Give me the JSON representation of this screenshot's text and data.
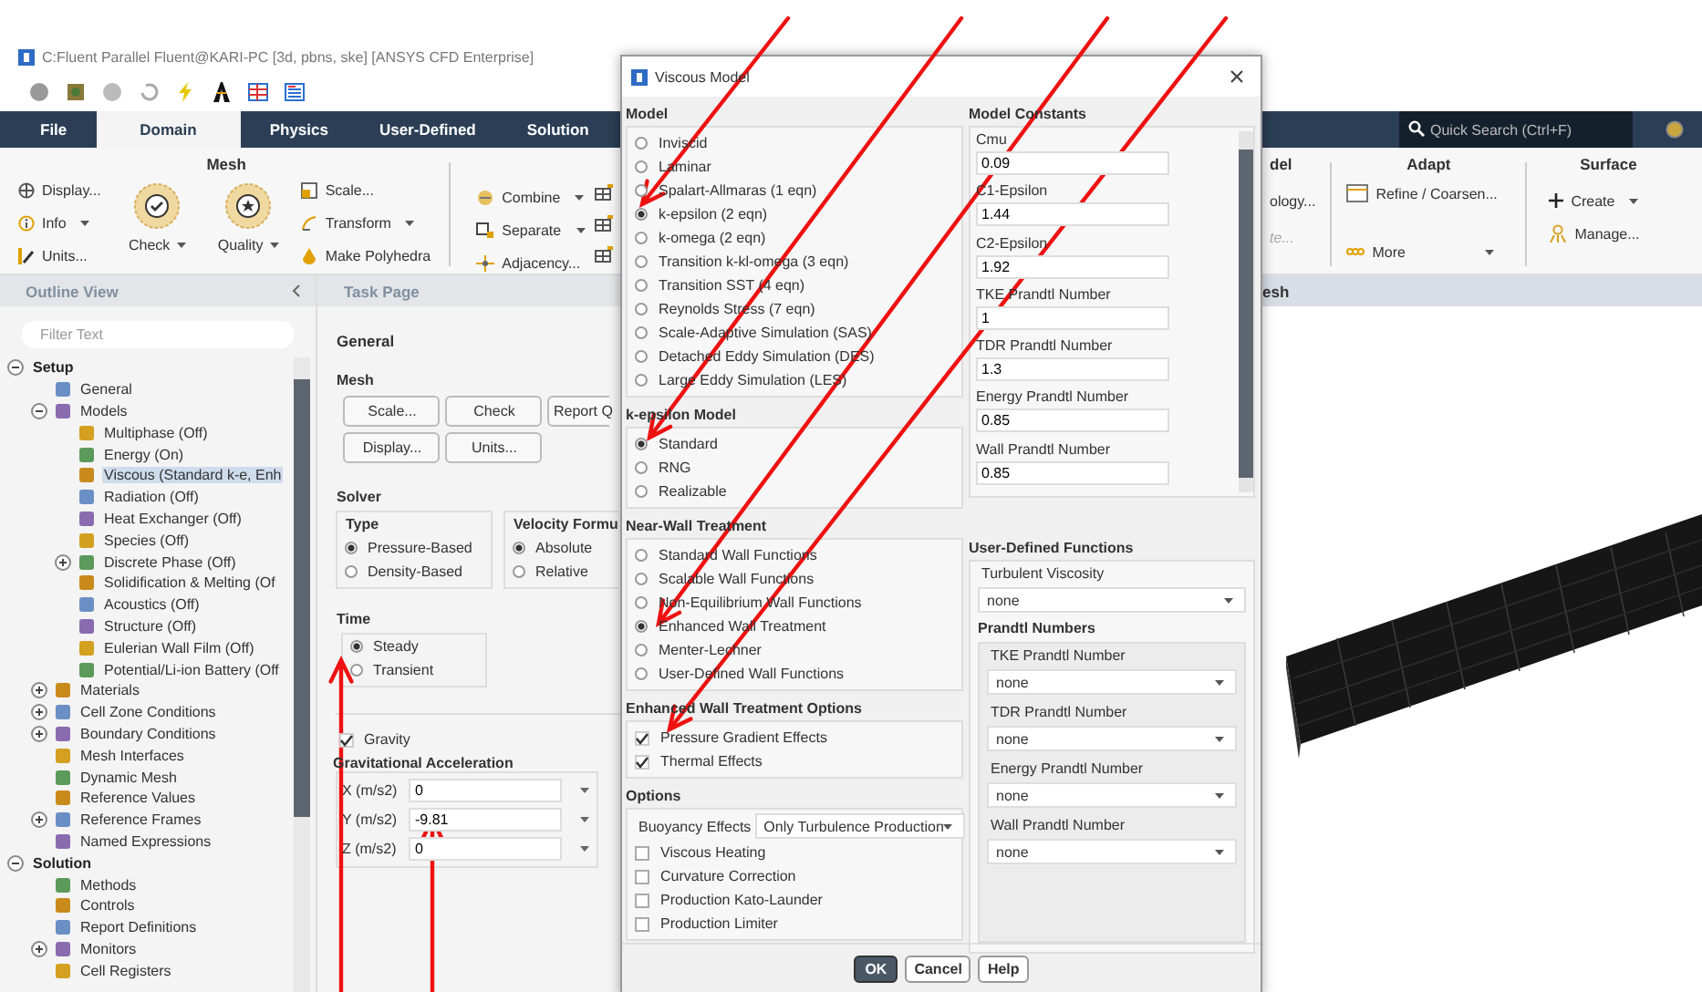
{
  "window": {
    "title": "C:Fluent Parallel Fluent@KARI-PC  [3d, pbns, ske] [ANSYS CFD Enterprise]"
  },
  "ribbon_tabs": [
    {
      "label": "File",
      "selected": false
    },
    {
      "label": "Domain",
      "selected": true
    },
    {
      "label": "Physics",
      "selected": false
    },
    {
      "label": "User-Defined",
      "selected": false
    },
    {
      "label": "Solution",
      "selected": false
    }
  ],
  "quick_search": {
    "placeholder": "Quick Search (Ctrl+F)"
  },
  "ribbon": {
    "mesh_group": {
      "title": "Mesh",
      "col1": [
        "Display...",
        "Info",
        "Units..."
      ],
      "check": "Check",
      "quality": "Quality",
      "col3": [
        "Scale...",
        "Transform",
        "Make Polyhedra"
      ]
    },
    "zones": [
      "Combine",
      "Separate",
      "Adjacency..."
    ],
    "partial_group": {
      "title": "del",
      "items": [
        {
          "label": "ology...",
          "disabled": false
        },
        {
          "label": "te...",
          "disabled": true
        }
      ]
    },
    "adapt": {
      "title": "Adapt",
      "items": [
        "Refine / Coarsen...",
        "More"
      ]
    },
    "surface": {
      "title": "Surface",
      "items": [
        "Create",
        "Manage..."
      ]
    }
  },
  "outline": {
    "header": "Outline View",
    "filter": {
      "placeholder": "Filter Text"
    },
    "items": [
      {
        "label": "Setup",
        "expanded": true,
        "selected": false,
        "children": [
          {
            "label": "General",
            "selected": false
          },
          {
            "label": "Models",
            "expanded": true,
            "selected": false,
            "children": [
              {
                "label": "Multiphase (Off)",
                "selected": false
              },
              {
                "label": "Energy (On)",
                "selected": false
              },
              {
                "label": "Viscous (Standard k-e, Enh",
                "selected": true
              },
              {
                "label": "Radiation (Off)",
                "selected": false
              },
              {
                "label": "Heat Exchanger (Off)",
                "selected": false
              },
              {
                "label": "Species (Off)",
                "selected": false
              },
              {
                "label": "Discrete Phase (Off)",
                "expanded": false,
                "selected": false
              },
              {
                "label": "Solidification & Melting (Of",
                "selected": false
              },
              {
                "label": "Acoustics (Off)",
                "selected": false
              },
              {
                "label": "Structure (Off)",
                "selected": false
              },
              {
                "label": "Eulerian Wall Film (Off)",
                "selected": false
              },
              {
                "label": "Potential/Li-ion Battery (Off",
                "selected": false
              }
            ]
          },
          {
            "label": "Materials",
            "expanded": false,
            "selected": false
          },
          {
            "label": "Cell Zone Conditions",
            "expanded": false,
            "selected": false
          },
          {
            "label": "Boundary Conditions",
            "expanded": false,
            "selected": false
          },
          {
            "label": "Mesh Interfaces",
            "selected": false
          },
          {
            "label": "Dynamic Mesh",
            "selected": false
          },
          {
            "label": "Reference Values",
            "selected": false
          },
          {
            "label": "Reference Frames",
            "expanded": false,
            "selected": false
          },
          {
            "label": "Named Expressions",
            "selected": false
          }
        ]
      },
      {
        "label": "Solution",
        "expanded": true,
        "selected": false,
        "children": [
          {
            "label": "Methods",
            "selected": false
          },
          {
            "label": "Controls",
            "selected": false
          },
          {
            "label": "Report Definitions",
            "selected": false
          },
          {
            "label": "Monitors",
            "expanded": false,
            "selected": false
          },
          {
            "label": "Cell Registers",
            "selected": false
          }
        ]
      }
    ]
  },
  "task_page": {
    "header": "Task Page",
    "title": "General",
    "mesh": {
      "label": "Mesh",
      "buttons": [
        "Scale...",
        "Check",
        "Report Q",
        "Display...",
        "Units..."
      ]
    },
    "solver": {
      "label": "Solver",
      "type": {
        "label": "Type",
        "options": [
          {
            "label": "Pressure-Based",
            "selected": true
          },
          {
            "label": "Density-Based",
            "selected": false
          }
        ]
      },
      "velocity": {
        "label": "Velocity Formu",
        "options": [
          {
            "label": "Absolute",
            "selected": true
          },
          {
            "label": "Relative",
            "selected": false
          }
        ]
      }
    },
    "time": {
      "label": "Time",
      "options": [
        {
          "label": "Steady",
          "selected": true
        },
        {
          "label": "Transient",
          "selected": false
        }
      ]
    },
    "gravity": {
      "label": "Gravity",
      "checked": true
    },
    "gravitational_acceleration": {
      "label": "Gravitational Acceleration",
      "fields": [
        {
          "label": "X (m/s2)",
          "value": "0"
        },
        {
          "label": "Y (m/s2)",
          "value": "-9.81"
        },
        {
          "label": "Z (m/s2)",
          "value": "0"
        }
      ]
    }
  },
  "graphics": {
    "header": "esh"
  },
  "dialog": {
    "title": "Viscous Model",
    "model": {
      "label": "Model",
      "options": [
        {
          "label": "Inviscid",
          "selected": false
        },
        {
          "label": "Laminar",
          "selected": false
        },
        {
          "label": "Spalart-Allmaras (1 eqn)",
          "selected": false
        },
        {
          "label": "k-epsilon (2 eqn)",
          "selected": true
        },
        {
          "label": "k-omega (2 eqn)",
          "selected": false
        },
        {
          "label": "Transition k-kl-omega (3 eqn)",
          "selected": false
        },
        {
          "label": "Transition SST (4 eqn)",
          "selected": false
        },
        {
          "label": "Reynolds Stress (7 eqn)",
          "selected": false
        },
        {
          "label": "Scale-Adaptive Simulation (SAS)",
          "selected": false
        },
        {
          "label": "Detached Eddy Simulation (DES)",
          "selected": false
        },
        {
          "label": "Large Eddy Simulation (LES)",
          "selected": false
        }
      ]
    },
    "k_epsilon_model": {
      "label": "k-epsilon Model",
      "options": [
        {
          "label": "Standard",
          "selected": true
        },
        {
          "label": "RNG",
          "selected": false
        },
        {
          "label": "Realizable",
          "selected": false
        }
      ]
    },
    "near_wall_treatment": {
      "label": "Near-Wall Treatment",
      "options": [
        {
          "label": "Standard Wall Functions",
          "selected": false
        },
        {
          "label": "Scalable Wall Functions",
          "selected": false
        },
        {
          "label": "Non-Equilibrium Wall Functions",
          "selected": false
        },
        {
          "label": "Enhanced Wall Treatment",
          "selected": true
        },
        {
          "label": "Menter-Lechner",
          "selected": false
        },
        {
          "label": "User-Defined Wall Functions",
          "selected": false
        }
      ]
    },
    "enhanced_wall_treatment_options": {
      "label": "Enhanced Wall Treatment Options",
      "options": [
        {
          "label": "Pressure Gradient Effects",
          "checked": true
        },
        {
          "label": "Thermal Effects",
          "checked": true
        }
      ]
    },
    "options": {
      "label": "Options",
      "buoyancy": {
        "label": "Buoyancy Effects",
        "value": "Only Turbulence Production"
      },
      "checkboxes": [
        {
          "label": "Viscous Heating",
          "checked": false
        },
        {
          "label": "Curvature Correction",
          "checked": false
        },
        {
          "label": "Production Kato-Launder",
          "checked": false
        },
        {
          "label": "Production Limiter",
          "checked": false
        }
      ]
    },
    "model_constants": {
      "label": "Model Constants",
      "items": [
        {
          "label": "Cmu",
          "value": "0.09"
        },
        {
          "label": "C1-Epsilon",
          "value": "1.44"
        },
        {
          "label": "C2-Epsilon",
          "value": "1.92"
        },
        {
          "label": "TKE Prandtl Number",
          "value": "1"
        },
        {
          "label": "TDR Prandtl Number",
          "value": "1.3"
        },
        {
          "label": "Energy Prandtl Number",
          "value": "0.85"
        },
        {
          "label": "Wall Prandtl Number",
          "value": "0.85"
        }
      ]
    },
    "user_defined_functions": {
      "label": "User-Defined Functions",
      "turbulent_viscosity": {
        "label": "Turbulent Viscosity",
        "value": "none"
      },
      "prandtl_numbers": {
        "label": "Prandtl Numbers",
        "items": [
          {
            "label": "TKE Prandtl Number",
            "value": "none"
          },
          {
            "label": "TDR Prandtl Number",
            "value": "none"
          },
          {
            "label": "Energy Prandtl Number",
            "value": "none"
          },
          {
            "label": "Wall Prandtl Number",
            "value": "none"
          }
        ]
      }
    },
    "buttons": [
      "OK",
      "Cancel",
      "Help"
    ]
  }
}
